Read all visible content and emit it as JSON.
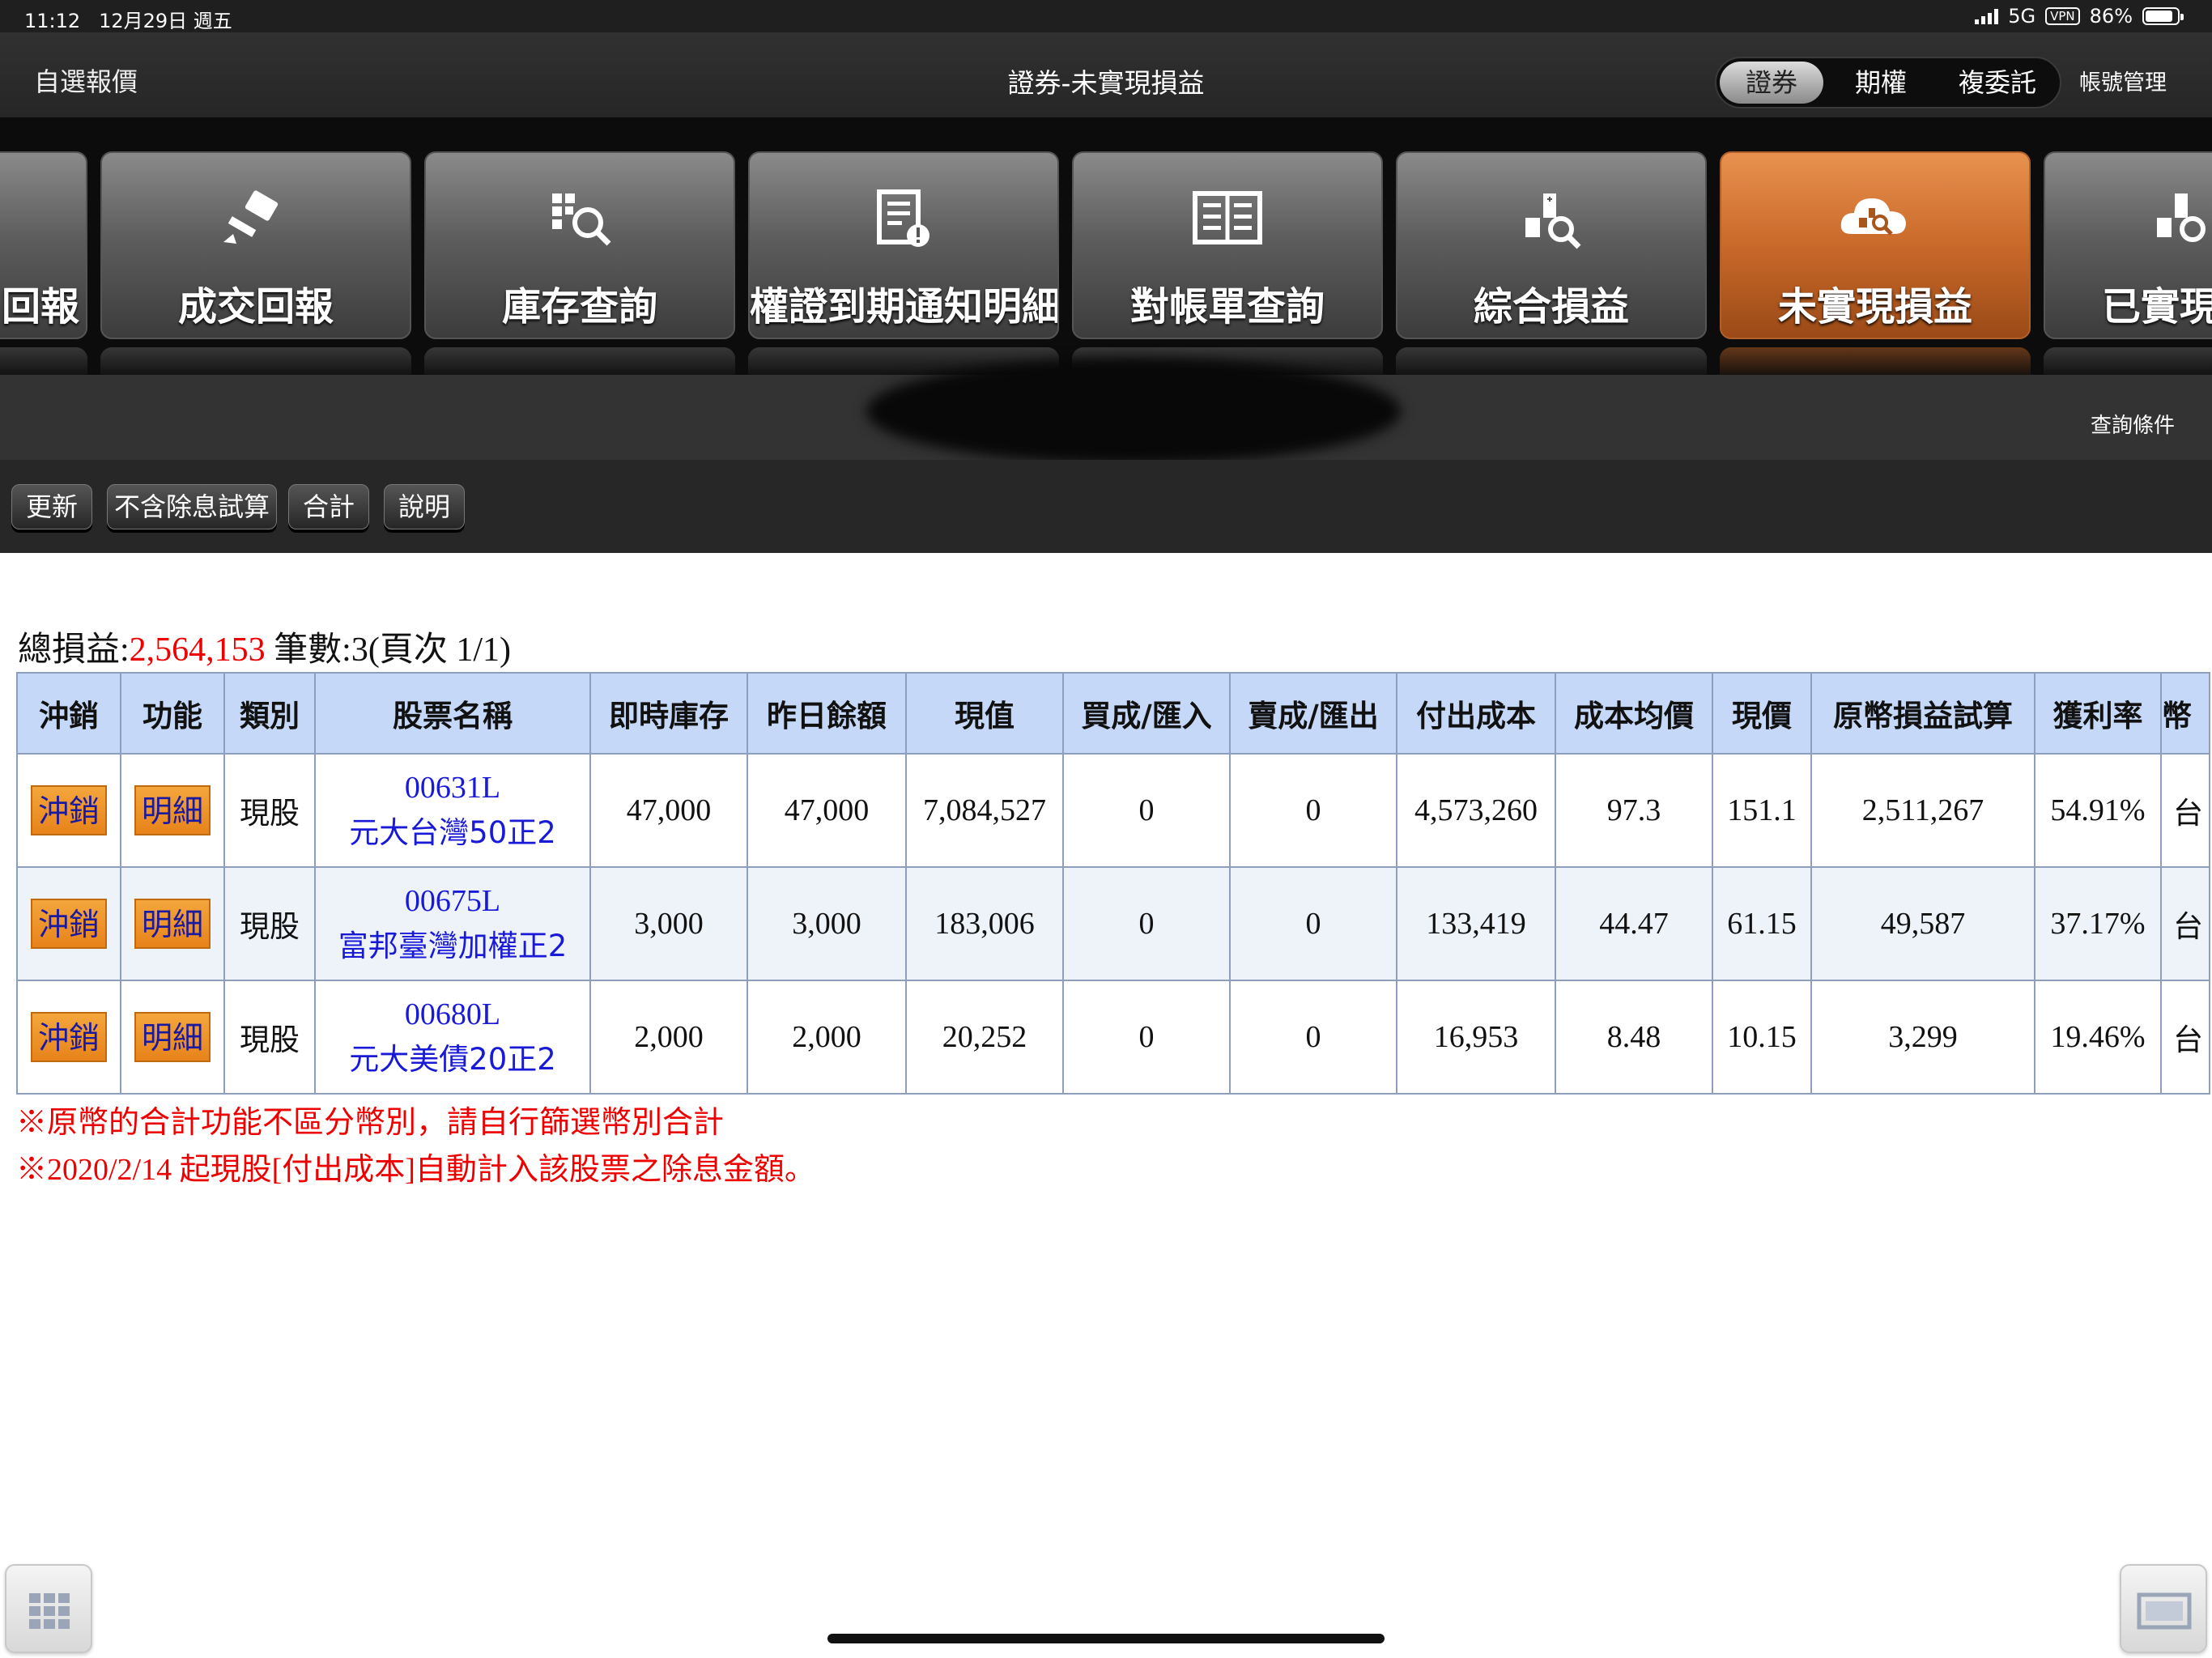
{
  "status": {
    "time": "11:12",
    "date": "12月29日 週五",
    "network": "5G",
    "vpn": "VPN",
    "battery": "86%",
    "battery_level": 0.86
  },
  "titlebar": {
    "left": "自選報價",
    "title": "證券-未實現損益",
    "segments": [
      "證券",
      "期權",
      "複委託"
    ],
    "account": "帳號管理"
  },
  "functions": [
    {
      "label": "回報",
      "icon": "none"
    },
    {
      "label": "成交回報",
      "icon": "hammer-icon"
    },
    {
      "label": "庫存查詢",
      "icon": "grid-search-icon"
    },
    {
      "label": "權證到期通知明細",
      "icon": "doc-alert-icon"
    },
    {
      "label": "對帳單查詢",
      "icon": "doc-list-icon"
    },
    {
      "label": "綜合損益",
      "icon": "calc-search-icon"
    },
    {
      "label": "未實現損益",
      "icon": "cloud-search-icon",
      "active": true
    },
    {
      "label": "已實現",
      "icon": "calc-search-icon"
    }
  ],
  "query": {
    "condition_label": "查詢條件"
  },
  "tools": [
    "更新",
    "不含除息試算",
    "合計",
    "說明"
  ],
  "summary": {
    "label_total": "總損益:",
    "total": "2,564,153",
    "label_count": "筆數:",
    "count": "3",
    "page": "(頁次 1/1)"
  },
  "table": {
    "headers": [
      "沖銷",
      "功能",
      "類別",
      "股票名稱",
      "即時庫存",
      "昨日餘額",
      "現值",
      "買成/匯入",
      "賣成/匯出",
      "付出成本",
      "成本均價",
      "現價",
      "原幣損益試算",
      "獲利率",
      "幣"
    ],
    "rows": [
      {
        "offset": "沖銷",
        "detail": "明細",
        "kind": "現股",
        "code": "00631L",
        "name": "元大台灣50正2",
        "inventory": "47,000",
        "prev": "47,000",
        "value": "7,084,527",
        "buy": "0",
        "sell": "0",
        "cost": "4,573,260",
        "avg": "97.3",
        "price": "151.1",
        "pnl": "2,511,267",
        "rate": "54.91%",
        "cur": "台"
      },
      {
        "offset": "沖銷",
        "detail": "明細",
        "kind": "現股",
        "code": "00675L",
        "name": "富邦臺灣加權正2",
        "inventory": "3,000",
        "prev": "3,000",
        "value": "183,006",
        "buy": "0",
        "sell": "0",
        "cost": "133,419",
        "avg": "44.47",
        "price": "61.15",
        "pnl": "49,587",
        "rate": "37.17%",
        "cur": "台"
      },
      {
        "offset": "沖銷",
        "detail": "明細",
        "kind": "現股",
        "code": "00680L",
        "name": "元大美債20正2",
        "inventory": "2,000",
        "prev": "2,000",
        "value": "20,252",
        "buy": "0",
        "sell": "0",
        "cost": "16,953",
        "avg": "8.48",
        "price": "10.15",
        "pnl": "3,299",
        "rate": "19.46%",
        "cur": "台"
      }
    ]
  },
  "notes": [
    "※原幣的合計功能不區分幣別，請自行篩選幣別合計",
    "※2020/2/14 起現股[付出成本]自動計入該股票之除息金額。"
  ]
}
